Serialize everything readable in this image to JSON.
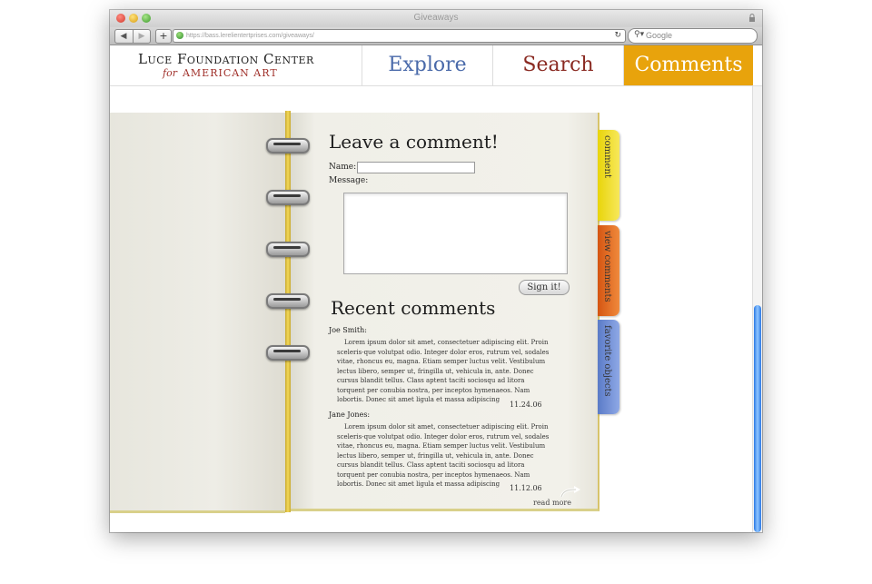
{
  "browser": {
    "title": "Giveaways",
    "url": "https://bass.lerelientertprises.com/giveaways/",
    "search_placeholder": "Google",
    "back_symbol": "◀",
    "forward_symbol": "▶",
    "add_symbol": "+",
    "reload_symbol": "↻",
    "search_symbol": "⚲▾"
  },
  "site": {
    "logo_main": "Luce Foundation Center",
    "logo_for": "for",
    "logo_sub": "AMERICAN ART",
    "nav": {
      "explore": "Explore",
      "search": "Search",
      "comments": "Comments"
    },
    "colors": {
      "explore": "#4a6aaa",
      "search": "#8a2a22",
      "comments_bg": "#e8a30c"
    }
  },
  "form": {
    "heading": "Leave a comment!",
    "name_label": "Name:",
    "message_label": "Message:",
    "submit_label": "Sign it!"
  },
  "recent": {
    "heading": "Recent comments",
    "comments": [
      {
        "author": "Joe Smith:",
        "body": "Lorem ipsum dolor sit amet, consectetuer adipiscing elit. Proin sceleris-que volutpat odio. Integer dolor eros, rutrum vel, sodales vitae, rhoncus eu, magna. Etiam semper luctus velit. Vestibulum lectus libero, semper ut, fringilla ut, vehicula in, ante. Donec cursus blandit tellus. Class aptent taciti sociosqu ad litora torquent per conubia nostra, per inceptos hymenaeos. Nam lobortis. Donec sit amet ligula et massa adipiscing",
        "date": "11.24.06"
      },
      {
        "author": "Jane Jones:",
        "body": "Lorem ipsum dolor sit amet, consectetuer adipiscing elit. Proin sceleris-que volutpat odio. Integer dolor eros, rutrum vel, sodales vitae, rhoncus eu, magna. Etiam semper luctus velit. Vestibulum lectus libero, semper ut, fringilla ut, vehicula in, ante. Donec cursus blandit tellus. Class aptent taciti sociosqu ad litora torquent per conubia nostra, per inceptos hymenaeos. Nam lobortis. Donec sit amet ligula et massa adipiscing",
        "date": "11.12.06"
      }
    ],
    "read_more": "read more"
  },
  "tabs": {
    "comment": "comment",
    "view_comments": "view comments",
    "favorite_objects": "favorite objects"
  },
  "icons": {
    "rings": "binder-ring-icon",
    "arrow": "curved-arrow-icon"
  }
}
